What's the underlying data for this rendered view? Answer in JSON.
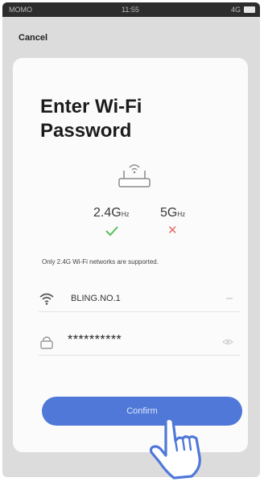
{
  "status_bar": {
    "carrier": "MOMO",
    "time": "11:55",
    "status": "4G"
  },
  "header": {
    "cancel_label": "Cancel"
  },
  "main": {
    "title": "Enter Wi-Fi Password",
    "bands": [
      {
        "label": "2.4G",
        "unit": "Hz",
        "supported": true,
        "mark_color": "#5bbf5a"
      },
      {
        "label": "5G",
        "unit": "Hz",
        "supported": false,
        "mark_color": "#e07068"
      }
    ],
    "note": "Only 2.4G Wi-Fi networks are supported.",
    "ssid": {
      "value": "BLING.NO.1",
      "icon": "wifi-icon"
    },
    "password": {
      "value": "**********",
      "icon": "lock-icon"
    },
    "confirm_label": "Confirm",
    "accent_color": "#4f78d8"
  }
}
